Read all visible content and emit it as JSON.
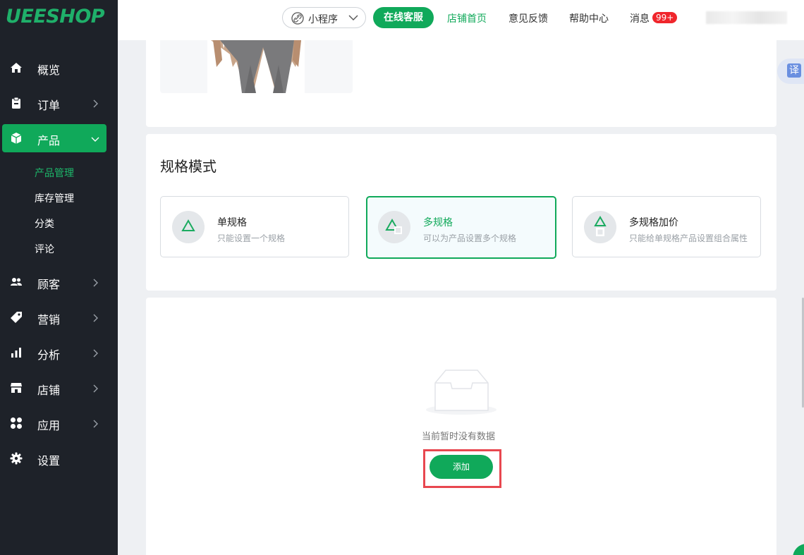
{
  "sidebar": {
    "logo": "UEESHOP",
    "items": [
      {
        "label": "概览"
      },
      {
        "label": "订单"
      },
      {
        "label": "产品"
      },
      {
        "label": "顾客"
      },
      {
        "label": "营销"
      },
      {
        "label": "分析"
      },
      {
        "label": "店铺"
      },
      {
        "label": "应用"
      },
      {
        "label": "设置"
      }
    ],
    "product_sub": [
      "产品管理",
      "库存管理",
      "分类",
      "评论"
    ],
    "current_sub": "产品管理"
  },
  "header": {
    "mini_program": "小程序",
    "online_service": "在线客服",
    "links": [
      "店铺首页",
      "意见反馈",
      "帮助中心",
      "消息"
    ],
    "message_badge": "99+"
  },
  "spec": {
    "title": "规格模式",
    "options": [
      {
        "title": "单规格",
        "desc": "只能设置一个规格"
      },
      {
        "title": "多规格",
        "desc": "可以为产品设置多个规格"
      },
      {
        "title": "多规格加价",
        "desc": "只能给单规格产品设置组合属性"
      }
    ],
    "selected": "多规格"
  },
  "empty": {
    "text": "当前暂时没有数据",
    "add_label": "添加"
  },
  "translate": {
    "label": "译"
  },
  "colors": {
    "brand_green": "#10a95a",
    "sidebar_bg": "#1e2229",
    "badge_red": "#f0262c",
    "highlight_red": "#e8474f"
  },
  "icons": [
    "home-icon",
    "clipboard-icon",
    "box-icon",
    "users-icon",
    "tag-icon",
    "bar-chart-icon",
    "store-icon",
    "apps-icon",
    "gear-icon",
    "link-icon",
    "chevron-down-icon",
    "chevron-right-icon",
    "triangle-icon",
    "empty-box-icon"
  ]
}
